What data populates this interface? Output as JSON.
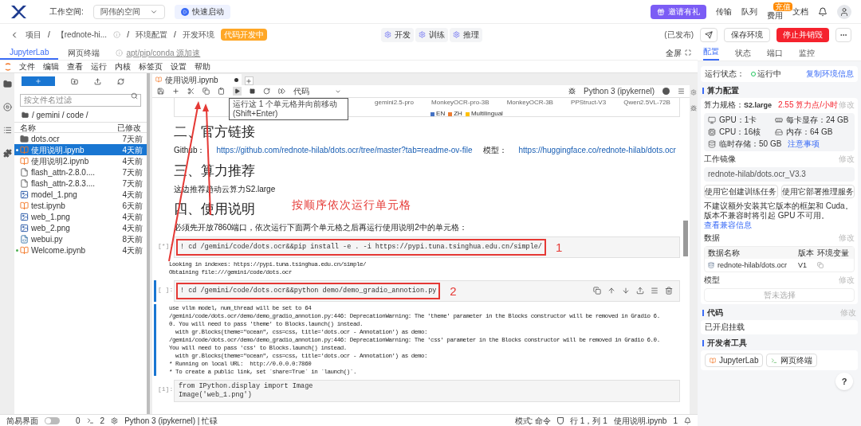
{
  "topbar": {
    "workspace_label": "工作空间:",
    "workspace": "阿伟的空间",
    "quick_start": "快速启动",
    "invite": "邀请有礼",
    "links": [
      {
        "label": "传输"
      },
      {
        "label": "队列"
      },
      {
        "label": "费用",
        "badge": "充值"
      },
      {
        "label": "文档"
      }
    ]
  },
  "breadcrumb": [
    {
      "kind": "item",
      "text": "项目"
    },
    {
      "kind": "separator",
      "text": "/"
    },
    {
      "kind": "item",
      "text": "【rednote-hi..."
    },
    {
      "kind": "separator",
      "text": "/"
    },
    {
      "kind": "item",
      "text": "环境配置"
    },
    {
      "kind": "separator",
      "text": "/"
    },
    {
      "kind": "item",
      "text": "开发环境"
    }
  ],
  "status_badge": "代码开发中",
  "modes": [
    {
      "label": "开发"
    },
    {
      "label": "训练"
    },
    {
      "label": "推理"
    }
  ],
  "actions": {
    "published": "(已发布)",
    "save": "保存环境",
    "stop": "停止并销毁"
  },
  "ide_tabs": [
    {
      "label": "JupyterLab",
      "selected": true
    },
    {
      "label": "网页终端",
      "selected": false
    }
  ],
  "mirror_link": "apt/pip/conda 源加速",
  "fullscreen": "全屏",
  "menu": [
    "文件",
    "编辑",
    "查看",
    "运行",
    "内核",
    "标签页",
    "设置",
    "帮助"
  ],
  "file_browser": {
    "filter_placeholder": "按文件名过滤",
    "path": "/ gemini / code /",
    "columns": [
      "名称",
      "已修改"
    ],
    "files": [
      {
        "name": "dots.ocr",
        "modified": "7天前",
        "kind": "folder",
        "selected": false,
        "running": false
      },
      {
        "name": "使用说明.ipynb",
        "modified": "4天前",
        "kind": "notebook",
        "selected": true,
        "running": true
      },
      {
        "name": "使用说明2.ipynb",
        "modified": "4天前",
        "kind": "notebook",
        "selected": false,
        "running": false
      },
      {
        "name": "flash_attn-2.8.0....",
        "modified": "7天前",
        "kind": "file",
        "selected": false,
        "running": false
      },
      {
        "name": "flash_attn-2.8.3....",
        "modified": "7天前",
        "kind": "file",
        "selected": false,
        "running": false
      },
      {
        "name": "model_1.png",
        "modified": "4天前",
        "kind": "image",
        "selected": false,
        "running": false
      },
      {
        "name": "test.ipynb",
        "modified": "6天前",
        "kind": "notebook",
        "selected": false,
        "running": false
      },
      {
        "name": "web_1.png",
        "modified": "4天前",
        "kind": "image",
        "selected": false,
        "running": false
      },
      {
        "name": "web_2.png",
        "modified": "4天前",
        "kind": "image",
        "selected": false,
        "running": false
      },
      {
        "name": "webui.py",
        "modified": "8天前",
        "kind": "python",
        "selected": false,
        "running": false
      },
      {
        "name": "Welcome.ipynb",
        "modified": "4天前",
        "kind": "notebook",
        "selected": false,
        "running": true
      }
    ]
  },
  "notebook": {
    "tab": "使用说明.ipynb",
    "cell_type": "代码",
    "kernel": "Python 3 (ipykernel)",
    "tooltip": "运行这 1 个单元格并向前移动 (Shift+Enter)",
    "chart_models": [
      "gemini2.5-pro",
      "MonkeyOCR-pro-3B",
      "MonkeyOCR-3B",
      "PPStruct-V3",
      "Qwen2.5VL-72B"
    ],
    "legend": [
      {
        "label": "EN",
        "color": "#4472c4"
      },
      {
        "label": "ZH",
        "color": "#ed7d31"
      },
      {
        "label": "Multilingual",
        "color": "#ffc000"
      }
    ],
    "blocks": [
      {
        "kind": "heading",
        "text": "二、官方链接"
      },
      {
        "kind": "links",
        "parts": [
          {
            "text": "Github：",
            "link": false
          },
          {
            "text": "https://github.com/rednote-hilab/dots.ocr/tree/master?tab=readme-ov-file",
            "link": true
          },
          {
            "text": "模型：",
            "link": false
          },
          {
            "text": "https://huggingface.co/rednote-hilab/dots.ocr",
            "link": true
          }
        ]
      },
      {
        "kind": "heading",
        "text": "三、算力推荐"
      },
      {
        "kind": "paragraph",
        "text": "这边推荐趋动云算力S2.large"
      },
      {
        "kind": "heading",
        "text": "四、使用说明"
      },
      {
        "kind": "paragraph",
        "text": "必须先开放7860端口，依次运行下面两个单元格之后再运行使用说明2中的单元格："
      },
      {
        "kind": "code",
        "prompt": "[*]:",
        "active": false,
        "marker": "1",
        "code": [
          "! cd /gemini/code/dots.ocr&&pip install -e . -i https://pypi.tuna.tsinghua.edu.cn/simple/"
        ],
        "output": [
          "Looking in indexes: https://pypi.tuna.tsinghua.edu.cn/simple/",
          "Obtaining file:///gemini/code/dots.ocr"
        ]
      },
      {
        "kind": "code",
        "prompt": "[ ]:",
        "active": true,
        "marker": "2",
        "code": [
          "! cd /gemini/code/dots.ocr&&python demo/demo_gradio_annotion.py"
        ],
        "output": [
          "use vllm model, num_thread will be set to 64",
          "/gemini/code/dots.ocr/demo/demo_gradio_annotion.py:446: DeprecationWarning: The 'theme' parameter in the Blocks constructor will be removed in Gradio 6.",
          "0. You will need to pass 'theme' to Blocks.launch() instead.",
          "  with gr.Blocks(theme=\"ocean\", css=css, title='dots.ocr - Annotation') as demo:",
          "/gemini/code/dots.ocr/demo/demo_gradio_annotion.py:446: DeprecationWarning: The 'css' parameter in the Blocks constructor will be removed in Gradio 6.0.",
          "You will need to pass 'css' to Blocks.launch() instead.",
          "  with gr.Blocks(theme=\"ocean\", css=css, title='dots.ocr - Annotation') as demo:",
          "* Running on local URL:  http://0.0.0.0:7860",
          "* To create a public link, set `share=True` in `launch()`."
        ]
      },
      {
        "kind": "code",
        "prompt": "[1]:",
        "active": false,
        "code": [
          "from IPython.display import Image",
          "Image('web_1.png')"
        ]
      }
    ]
  },
  "annotation_note": "按顺序依次运行单元格",
  "status_bar": {
    "simple_mode": "简易界面",
    "simple_on": false,
    "terminals": "0",
    "kernels": "2",
    "kernel": "Python 3 (ipykernel) | 忙碌",
    "mode": "模式: 命令",
    "position": "行 1，列 1",
    "file": "使用说明.ipynb",
    "notifications": "1"
  },
  "right_panel": {
    "tabs": [
      {
        "label": "配置",
        "selected": true
      },
      {
        "label": "状态",
        "selected": false
      },
      {
        "label": "端口",
        "selected": false
      },
      {
        "label": "监控",
        "selected": false
      }
    ],
    "run_status_label": "运行状态：",
    "run_status": "运行中",
    "copy_link": "复制环境信息",
    "compute_title": "算力配置",
    "spec_label": "算力规格：",
    "spec": "S2.large",
    "price": "2.55 算力点/小时",
    "compute_edit": "修改",
    "specs": [
      {
        "kind": "gpu",
        "text": "GPU：1卡"
      },
      {
        "kind": "vram",
        "text": "每卡显存：24 GB"
      },
      {
        "kind": "cpu",
        "text": "CPU：16核"
      },
      {
        "kind": "memory",
        "text": "内存：64 GB"
      },
      {
        "kind": "storage",
        "text": "临时存储：50 GB"
      }
    ],
    "specs_link": "注意事项",
    "image_title": "工作镜像",
    "image_edit": "修改",
    "image": "rednote-hilab/dots.ocr_V3.3",
    "image_buttons": [
      "使用它创建训练任务",
      "使用它部署推理服务"
    ],
    "warning": "不建议额外安装其它版本的框架和 Cuda。版本不兼容时将引起 GPU 不可用。",
    "warning_link": "查看兼容信息",
    "data_title": "数据",
    "data_edit": "修改",
    "data_columns": [
      "数据名称",
      "版本",
      "环境变量"
    ],
    "data_rows": [
      {
        "name": "rednote-hilab/dots.ocr",
        "version": "V1"
      }
    ],
    "model_title": "模型",
    "model_edit": "修改",
    "model_empty": "暂未选择",
    "code_title": "代码",
    "code_edit": "修改",
    "code_value": "已开启挂载",
    "tools_title": "开发者工具",
    "tools": [
      "JupyterLab",
      "网页终端"
    ],
    "help": "?"
  }
}
